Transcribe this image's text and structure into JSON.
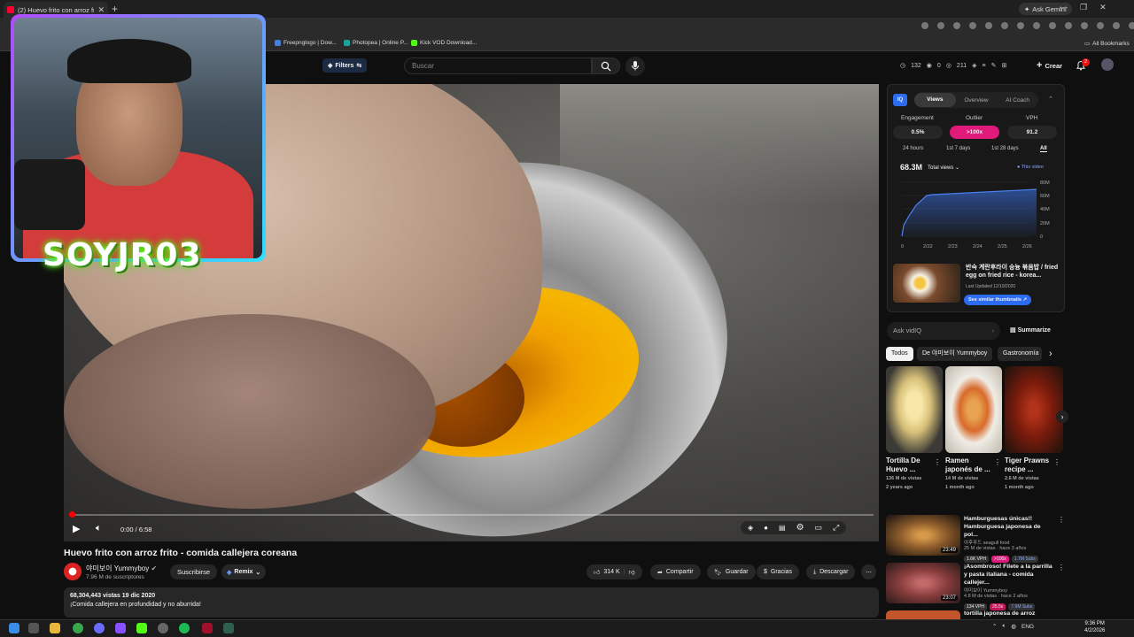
{
  "browser": {
    "tab_title": "(2) Huevo frito con arroz frito",
    "ask_gemini": "Ask Gemini",
    "bookmarks": [
      "Freepnglogo | Dow...",
      "Photopea | Online P...",
      "Kick VOD Download..."
    ],
    "all_bookmarks": "All Bookmarks"
  },
  "header": {
    "filters": "Filters",
    "search_placeholder": "Buscar",
    "stats": [
      "132",
      "0",
      "211"
    ],
    "create": "Crear",
    "notif_count": "2"
  },
  "player": {
    "time": "0:00 / 6:58",
    "progress_fraction": 0.0
  },
  "overlay": {
    "streamer_name": "SOYJR03"
  },
  "video": {
    "title": "Huevo frito con arroz frito - comida callejera coreana",
    "channel": "야미보이 Yummyboy",
    "subscribers": "7.96 M de suscriptores",
    "subscribe": "Suscribirse",
    "remix": "Remix",
    "likes": "314 K",
    "share": "Compartir",
    "save": "Guardar",
    "thanks": "Gracias",
    "download": "Descargar",
    "desc_line1": "68,304,443 vistas  19 dic 2020",
    "desc_line2": "¡Comida callejera en profundidad y no aburrida!"
  },
  "vidiq": {
    "logo": "IQ",
    "tabs": [
      "Views",
      "Overview",
      "AI Coach"
    ],
    "metrics": [
      {
        "label": "Engagement",
        "value": "0.5%"
      },
      {
        "label": "Outlier",
        "value": ">100x"
      },
      {
        "label": "VPH",
        "value": "91.2"
      }
    ],
    "ranges": [
      "24 hours",
      "1st 7 days",
      "1st 28 days",
      "All"
    ],
    "total": "68.3M",
    "total_label": "Total views",
    "this_video": "This video",
    "chart_x": [
      "0",
      "2/22",
      "2/23",
      "2/24",
      "2/25",
      "2/26"
    ],
    "chart_y": [
      "80M",
      "60M",
      "40M",
      "20M",
      "0"
    ],
    "related_title": "반숙 계란후라이 숭늉 볶음밥 / fried egg on fried rice - korea...",
    "last_updated": "Last Updated 12/19/2020",
    "see_similar": "See similar thumbnails",
    "ask": "Ask vidIQ",
    "summarize": "Summarize"
  },
  "chips": [
    "Todos",
    "De 야미보이 Yummyboy",
    "Gastronomía"
  ],
  "shorts": [
    {
      "title": "Tortilla De Huevo ...",
      "views": "136 M de vistas",
      "age": "2 years ago"
    },
    {
      "title": "Ramen japonés de ...",
      "views": "14 M de vistas",
      "age": "1 month ago"
    },
    {
      "title": "Tiger Prawns recipe ...",
      "views": "2.6 M de vistas",
      "age": "1 month ago"
    }
  ],
  "related": [
    {
      "title": "Hamburguesas únicas!! Hamburguesa japonesa de pol...",
      "channel": "야후푸드 seagull food",
      "meta": "25 M de vistas · hace 3 años",
      "duration": "23:49",
      "vph": "1.6K VPH",
      "outlier": ">100x",
      "subs": "1.7M Subs"
    },
    {
      "title": "¡Asombroso! Filete a la parrilla y pasta italiana - comida callejer...",
      "channel": "야미보이 Yummyboy",
      "meta": "4.8 M de vistas · hace 2 años",
      "duration": "23:07",
      "vph": "134 VPH",
      "outlier": "25.5x",
      "subs": "7.9M Subs"
    },
    {
      "title": "tortilla japonesa de arroz",
      "channel": "",
      "meta": "",
      "duration": "",
      "vph": "",
      "outlier": "",
      "subs": ""
    }
  ],
  "taskbar": {
    "lang": "ENG",
    "time": "9:36 PM",
    "date": "4/2/2026"
  }
}
